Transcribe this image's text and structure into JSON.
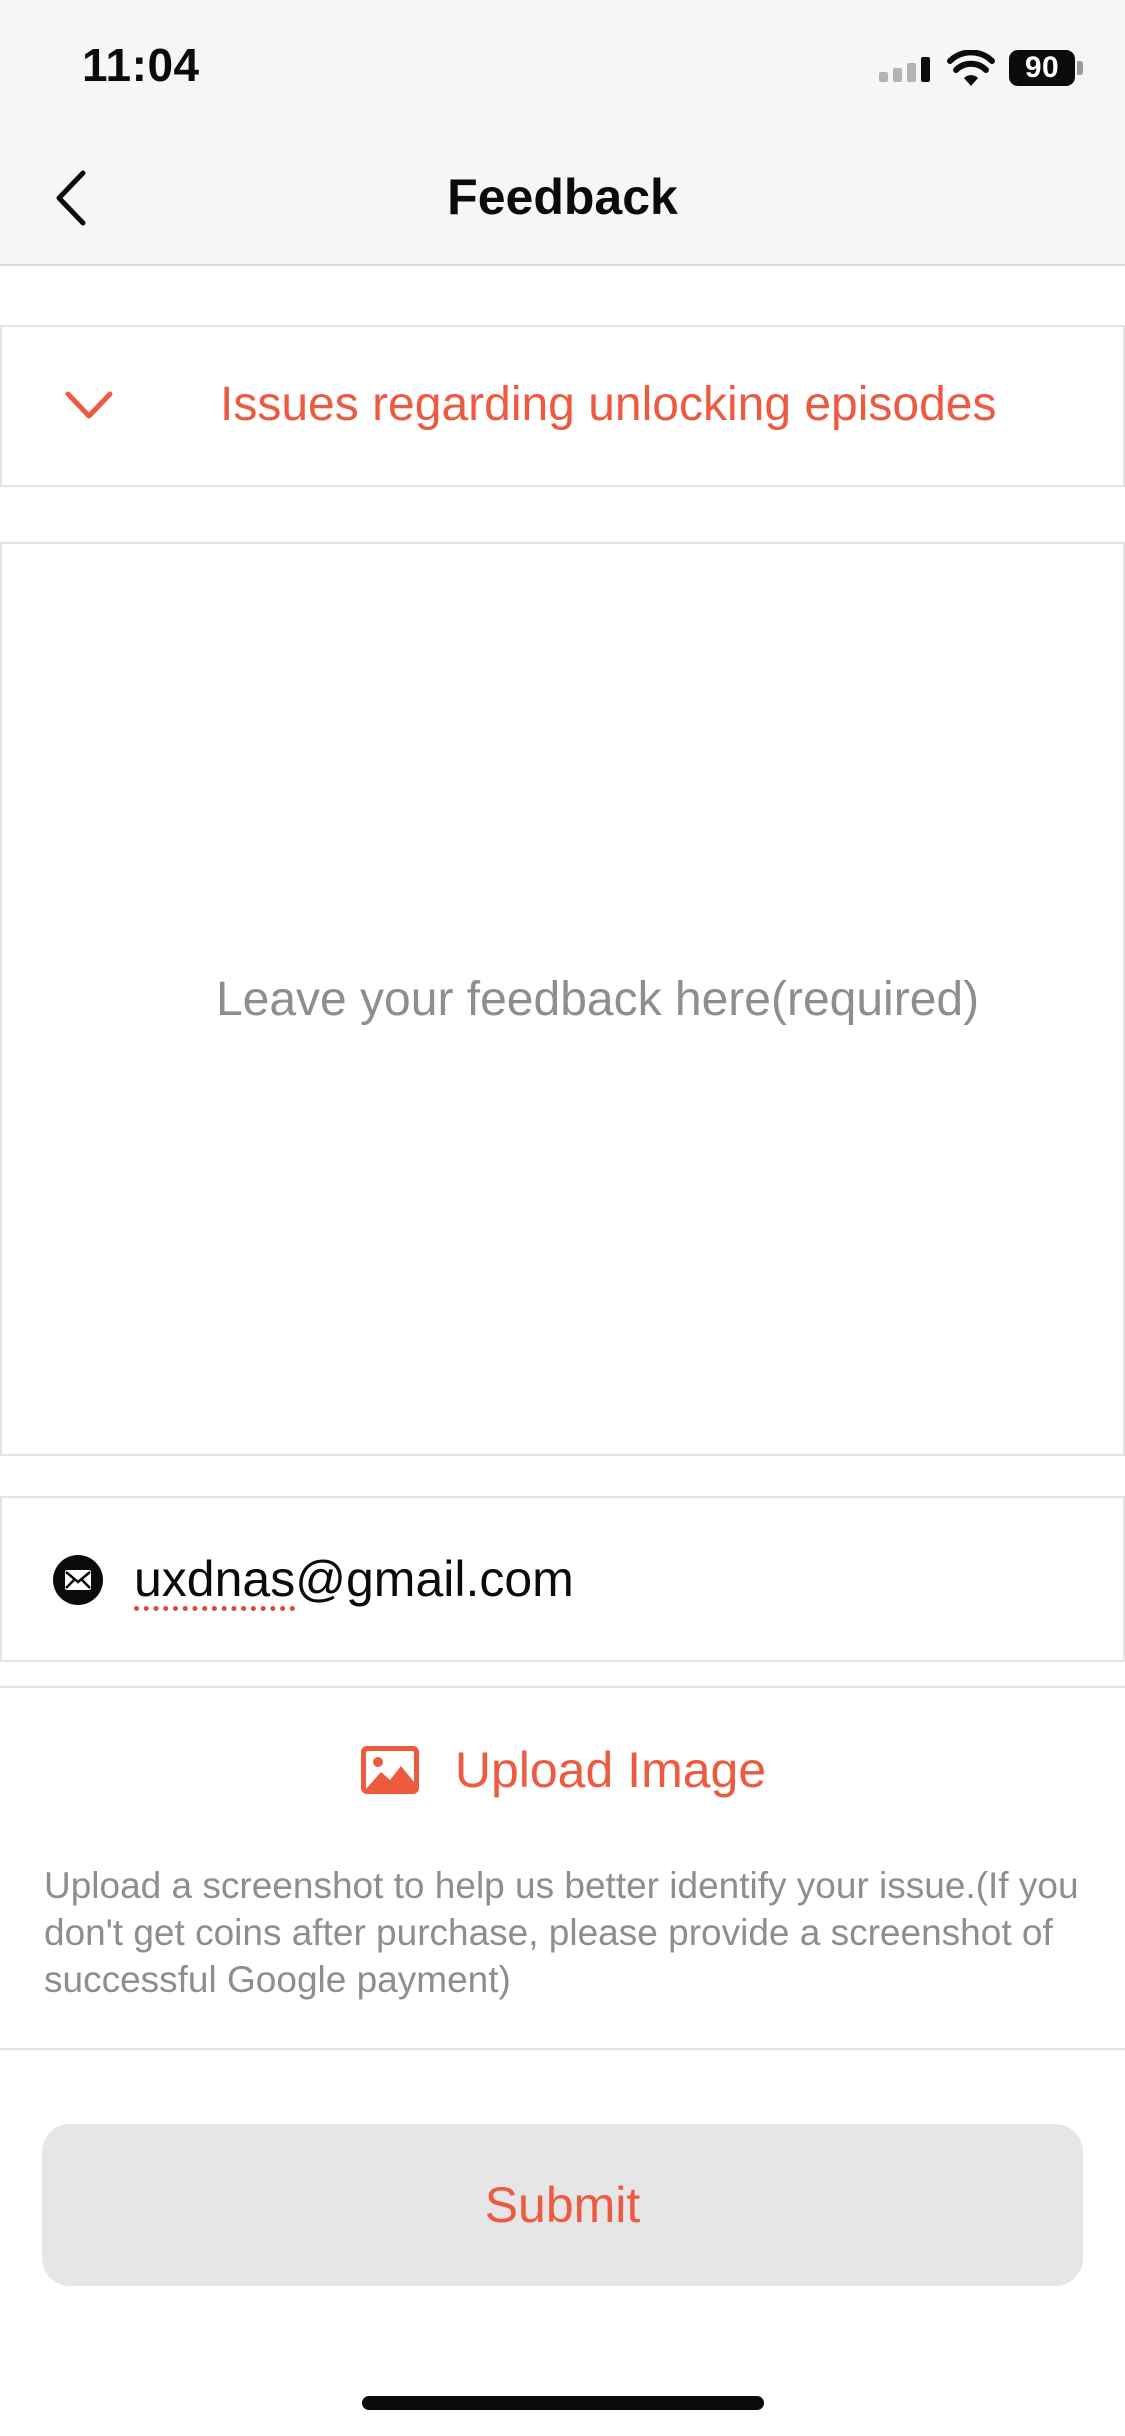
{
  "status_bar": {
    "time": "11:04",
    "battery": "90"
  },
  "nav": {
    "title": "Feedback"
  },
  "category": {
    "selected": "Issues regarding unlocking episodes"
  },
  "feedback": {
    "placeholder": "Leave your feedback here(required)"
  },
  "email": {
    "user": "uxdnas",
    "domain": "@gmail.com"
  },
  "upload": {
    "label": "Upload Image",
    "hint": "Upload a screenshot to help us better identify your issue.(If you don't get coins after purchase, please provide a screenshot of successful Google payment)"
  },
  "submit": {
    "label": "Submit"
  },
  "colors": {
    "accent": "#ee5a3f",
    "placeholder": "#8e8e8e",
    "button_bg": "#e6e6e6"
  },
  "icons": {
    "back": "chevron-left-icon",
    "dropdown": "chevron-down-icon",
    "email": "envelope-icon",
    "upload": "image-icon",
    "signal": "cellular-signal-icon",
    "wifi": "wifi-icon",
    "battery": "battery-icon"
  }
}
